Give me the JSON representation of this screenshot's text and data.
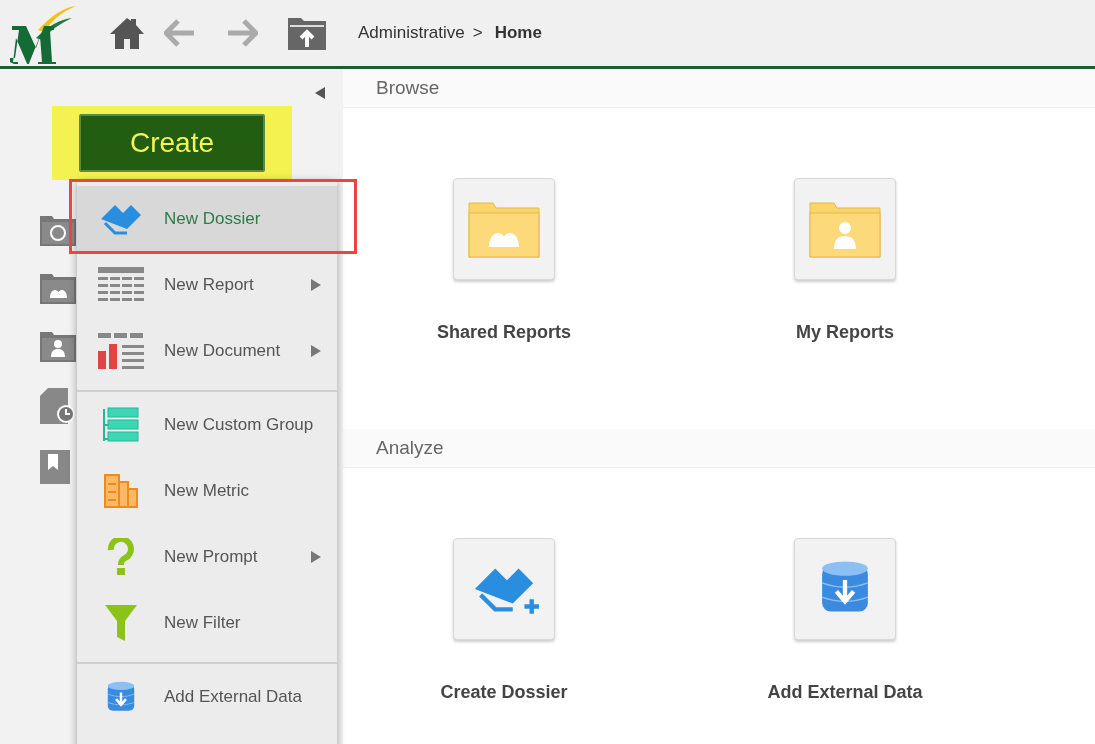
{
  "breadcrumb": [
    {
      "label": "Administrative",
      "current": false
    },
    {
      "label": "Home",
      "current": true
    }
  ],
  "breadcrumb_separator": ">",
  "create_button": {
    "label": "Create",
    "highlighted": true
  },
  "create_menu": [
    {
      "kind": "dossier",
      "label": "New Dossier",
      "selected": true,
      "submenu": false,
      "divider_before": false
    },
    {
      "kind": "report",
      "label": "New Report",
      "selected": false,
      "submenu": true,
      "divider_before": false
    },
    {
      "kind": "document",
      "label": "New Document",
      "selected": false,
      "submenu": true,
      "divider_before": false
    },
    {
      "kind": "custom-group",
      "label": "New Custom Group",
      "selected": false,
      "submenu": false,
      "divider_before": true
    },
    {
      "kind": "metric",
      "label": "New Metric",
      "selected": false,
      "submenu": false,
      "divider_before": false
    },
    {
      "kind": "prompt",
      "label": "New Prompt",
      "selected": false,
      "submenu": true,
      "divider_before": false
    },
    {
      "kind": "filter",
      "label": "New Filter",
      "selected": false,
      "submenu": false,
      "divider_before": false
    },
    {
      "kind": "external-data",
      "label": "Add External Data",
      "selected": false,
      "submenu": false,
      "divider_before": true
    }
  ],
  "sidebar_items": [
    {
      "kind": "recent"
    },
    {
      "kind": "shared"
    },
    {
      "kind": "personal"
    },
    {
      "kind": "history"
    },
    {
      "kind": "subscriptions"
    }
  ],
  "sections": [
    {
      "title": "Browse",
      "tiles": [
        {
          "kind": "shared-folder",
          "label": "Shared Reports"
        },
        {
          "kind": "my-folder",
          "label": "My Reports"
        }
      ]
    },
    {
      "title": "Analyze",
      "tiles": [
        {
          "kind": "dossier",
          "label": "Create Dossier"
        },
        {
          "kind": "external-data",
          "label": "Add External Data"
        }
      ]
    }
  ]
}
